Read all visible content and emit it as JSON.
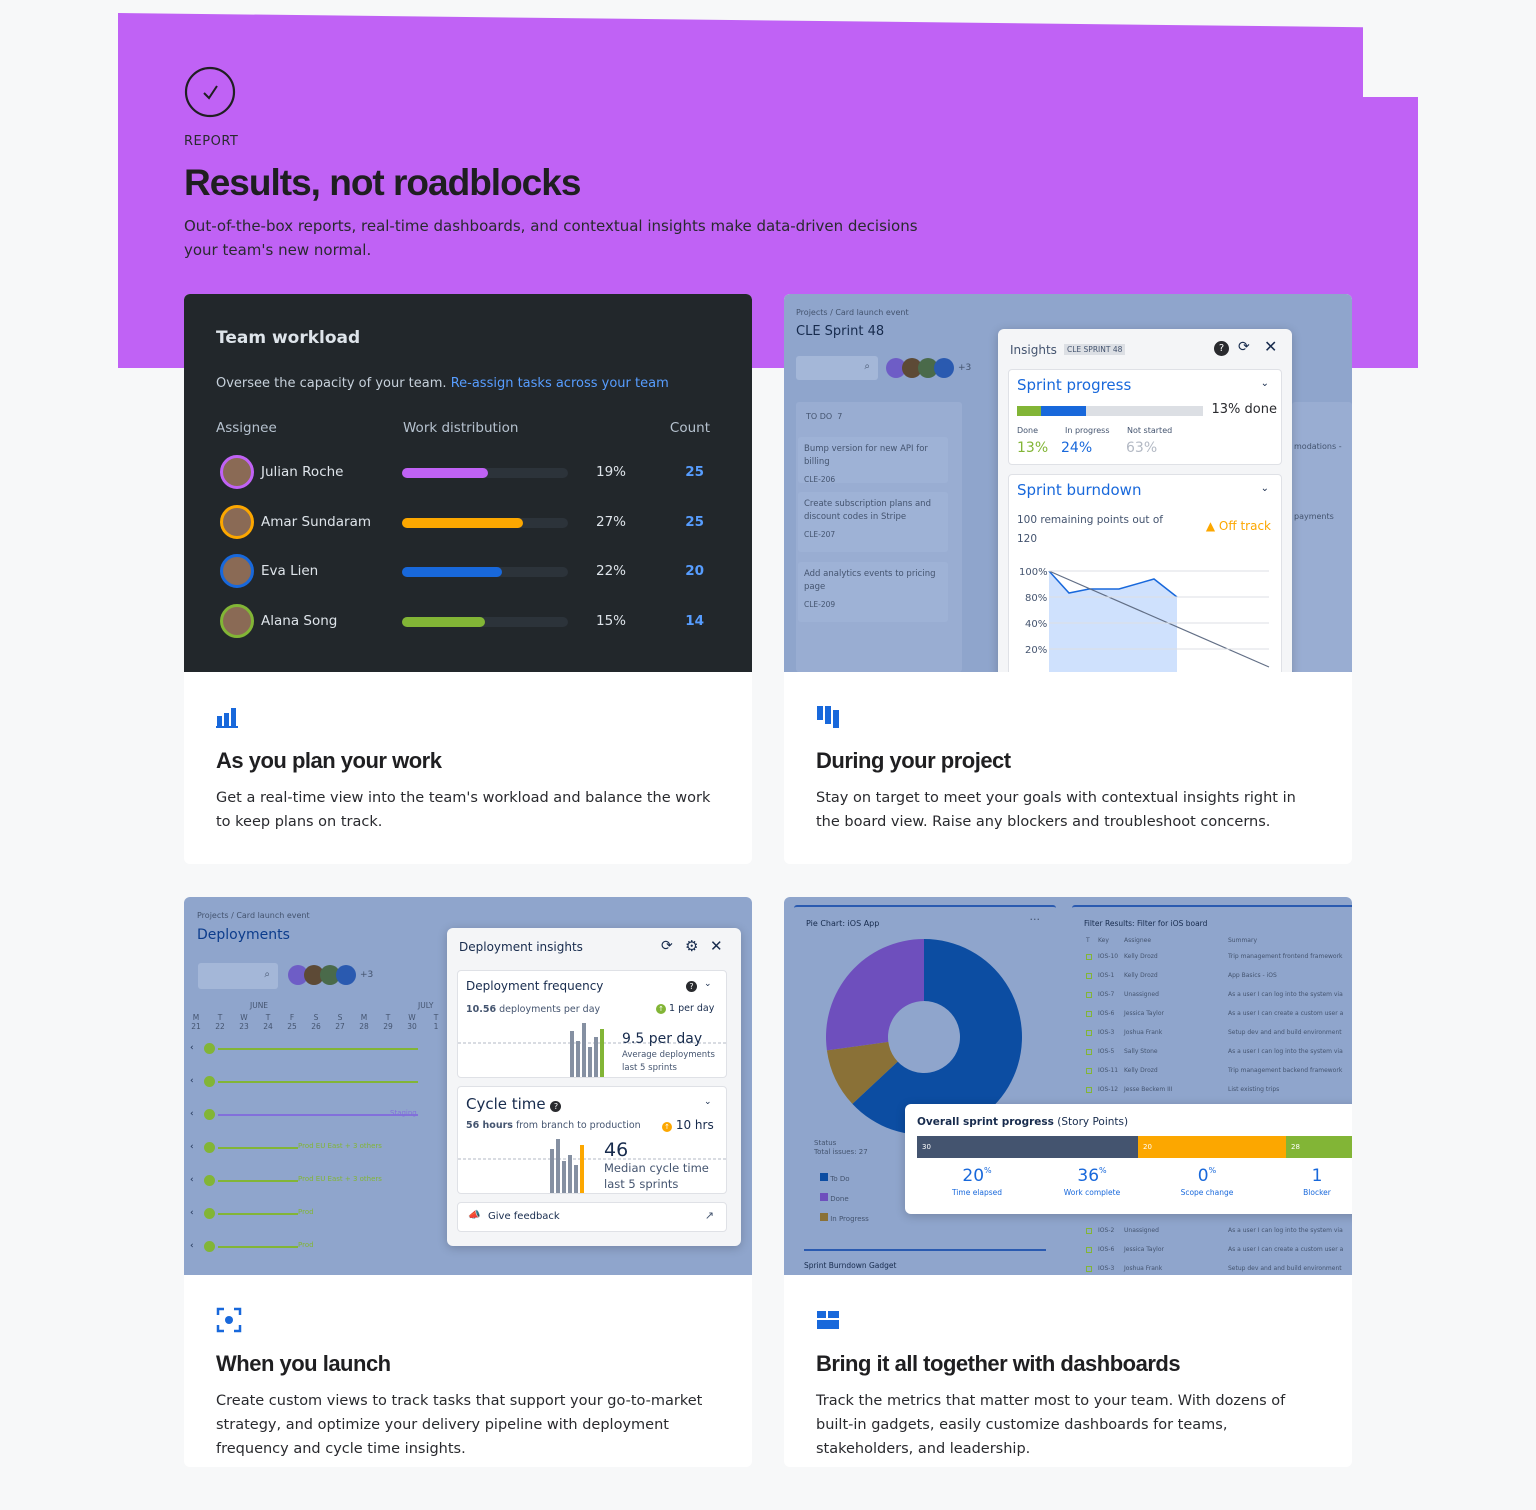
{
  "header": {
    "eyebrow": "REPORT",
    "title": "Results, not roadblocks",
    "subtitle": "Out-of-the-box reports, real-time dashboards, and contextual insights make data-driven decisions your team's new normal."
  },
  "workload": {
    "title": "Team workload",
    "desc": "Oversee the capacity of your team.",
    "link": "Re-assign tasks across your team",
    "col_assignee": "Assignee",
    "col_distribution": "Work distribution",
    "col_count": "Count",
    "rows": [
      {
        "name": "Julian Roche",
        "pct_label": "19%",
        "pct": 0.52,
        "count": "25",
        "color": "#c062f5"
      },
      {
        "name": "Amar Sundaram",
        "pct_label": "27%",
        "pct": 0.73,
        "count": "25",
        "color": "#fca700"
      },
      {
        "name": "Eva Lien",
        "pct_label": "22%",
        "pct": 0.6,
        "count": "20",
        "color": "#1868db"
      },
      {
        "name": "Alana Song",
        "pct_label": "15%",
        "pct": 0.5,
        "count": "14",
        "color": "#82b536"
      }
    ]
  },
  "sprint": {
    "breadcrumb": "Projects / Card launch event",
    "board_title": "CLE Sprint 48",
    "avatar_more": "+3",
    "todo_label": "TO DO",
    "todo_count": "7",
    "cards": [
      {
        "text": "Bump version for new API for billing",
        "key": "CLE-206"
      },
      {
        "text": "Create subscription plans and discount codes in Stripe",
        "key": "CLE-207"
      },
      {
        "text": "Add analytics events to pricing page",
        "key": "CLE-209"
      }
    ],
    "right_card_1": "modations -",
    "right_card_2": "payments",
    "insights_title": "Insights",
    "insights_badge": "CLE SPRINT 48",
    "progress_title": "Sprint progress",
    "progress_done_label": "13% done",
    "done_label": "Done",
    "inprog_label": "In progress",
    "notstarted_label": "Not started",
    "done_val": "13%",
    "inprog_val": "24%",
    "notstarted_val": "63%",
    "done_frac": 0.13,
    "inprog_frac": 0.24,
    "burndown_title": "Sprint burndown",
    "burndown_text": "100 remaining points out of 120",
    "off_track": "Off track",
    "yticks": [
      "100%",
      "80%",
      "40%",
      "20%"
    ]
  },
  "deploy": {
    "breadcrumb": "Projects / Card launch event",
    "title": "Deployments",
    "avatar_more": "+3",
    "month1": "JUNE",
    "month2": "JULY",
    "days": [
      "M 21",
      "T 22",
      "W 23",
      "T 24",
      "F 25",
      "S 26",
      "S 27",
      "M 28",
      "T 29",
      "W 30",
      "T 1"
    ],
    "env_labels": [
      "Staging",
      "Prod EU East + 3 others",
      "Prod EU East + 3 others",
      "Prod",
      "Prod"
    ],
    "panel_title": "Deployment insights",
    "freq_title": "Deployment frequency",
    "freq_value": "10.56",
    "freq_unit": "deployments per day",
    "freq_delta": "1 per day",
    "freq_big": "9.5 per day",
    "freq_caption1": "Average deployments",
    "freq_caption2": "last 5 sprints",
    "cycle_title": "Cycle time",
    "cycle_value": "56 hours",
    "cycle_unit": "from branch to production",
    "cycle_delta": "10 hrs",
    "cycle_big": "46",
    "cycle_caption1": "Median cycle time",
    "cycle_caption2": "last 5 sprints",
    "feedback": "Give feedback"
  },
  "dashboard": {
    "pie_title": "Pie Chart: iOS App",
    "status_label": "Status",
    "total_issues": "Total issues: 27",
    "legend": [
      "To Do",
      "Done",
      "In Progress"
    ],
    "filter_title": "Filter Results: Filter for iOS board",
    "filter_cols": [
      "T",
      "Key",
      "Assignee",
      "Summary"
    ],
    "filter_rows": [
      [
        "IOS-10",
        "Kelly Drozd",
        "Trip management frontend framework"
      ],
      [
        "IOS-1",
        "Kelly Drozd",
        "App Basics - iOS"
      ],
      [
        "IOS-7",
        "Unassigned",
        "As a user I can log into the system via"
      ],
      [
        "IOS-6",
        "Jessica Taylor",
        "As a user I can create a custom user a"
      ],
      [
        "IOS-3",
        "Joshua Frank",
        "Setup dev and and build environment"
      ],
      [
        "IOS-5",
        "Sally Stone",
        "As a user I can log into the system via"
      ],
      [
        "IOS-11",
        "Kelly Drozd",
        "Trip management backend framework"
      ],
      [
        "IOS-12",
        "Jesse Beckem III",
        "List existing trips"
      ]
    ],
    "filter_rows_bottom": [
      [
        "IOS-2",
        "Unassigned",
        "As a user I can log into the system via"
      ],
      [
        "IOS-6",
        "Jessica Taylor",
        "As a user I can create a custom user a"
      ],
      [
        "IOS-3",
        "Joshua Frank",
        "Setup dev and and build environment"
      ]
    ],
    "overall_title": "Overall sprint progress",
    "overall_unit": "(Story Points)",
    "seg_values": [
      "30",
      "20",
      "28"
    ],
    "stats": [
      {
        "value": "20",
        "suffix": "%",
        "label": "Time elapsed"
      },
      {
        "value": "36",
        "suffix": "%",
        "label": "Work complete"
      },
      {
        "value": "0",
        "suffix": "%",
        "label": "Scope change"
      },
      {
        "value": "1",
        "suffix": "",
        "label": "Blocker"
      }
    ],
    "burndown_gadget": "Sprint Burndown Gadget"
  },
  "chart_data": {
    "type": "pie",
    "categories": [
      "To Do",
      "In Progress",
      "Done"
    ],
    "values": [
      0.58,
      0.09,
      0.25
    ],
    "colors": [
      "#0c4da2",
      "#8a7137",
      "#6e4fbd"
    ]
  },
  "cards": [
    {
      "title": "As you plan your work",
      "desc": "Get a real-time view into the team's workload and balance the work to keep plans on track."
    },
    {
      "title": "During your project",
      "desc": "Stay on target to meet your goals with contextual insights right in the board view. Raise any blockers and troubleshoot concerns."
    },
    {
      "title": "When you launch",
      "desc": "Create custom views to track tasks that support your go-to-market strategy, and optimize your delivery pipeline with deployment frequency and cycle time insights."
    },
    {
      "title": "Bring it all together with dashboards",
      "desc": "Track the metrics that matter most to your team. With dozens of built-in gadgets, easily customize dashboards for teams, stakeholders, and leadership."
    }
  ],
  "colors": {
    "accent": "#c062f5",
    "blue": "#1868db",
    "dark": "#22272b"
  }
}
